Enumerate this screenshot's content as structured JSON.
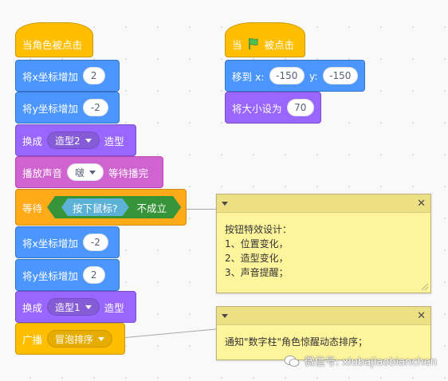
{
  "colors": {
    "events": "#ffbf00",
    "control": "#ffab19",
    "motion": "#4c97ff",
    "looks": "#9966ff",
    "sound": "#cf63cf",
    "operator": "#59c059",
    "sensing": "#5cb1d6",
    "note": "#fef49c"
  },
  "script1": {
    "hat_label": "当角色被点击",
    "change_x": {
      "label": "将x坐标增加",
      "value": "2"
    },
    "change_y": {
      "label": "将y坐标增加",
      "value": "-2"
    },
    "switch_costume": {
      "label": "换成",
      "value": "造型2",
      "suffix": "造型"
    },
    "play_sound": {
      "label": "播放声音",
      "value": "啵",
      "suffix": "等待播完"
    },
    "wait_until": {
      "label": "等待",
      "sensing": "按下鼠标?",
      "not_label": "不成立"
    },
    "change_x2": {
      "label": "将x坐标增加",
      "value": "-2"
    },
    "change_y2": {
      "label": "将y坐标增加",
      "value": "2"
    },
    "switch_costume2": {
      "label": "换成",
      "value": "造型1",
      "suffix": "造型"
    },
    "broadcast": {
      "label": "广播",
      "value": "冒泡排序"
    }
  },
  "script2": {
    "hat_prefix": "当",
    "hat_icon": "green-flag-icon",
    "hat_suffix": "被点击",
    "goto": {
      "label": "移到 x:",
      "x": "-150",
      "y_label": "y:",
      "y": "-150"
    },
    "set_size": {
      "label": "将大小设为",
      "value": "70"
    }
  },
  "note1": {
    "lines": [
      "按钮特效设计：",
      "1、位置变化，",
      "2、造型变化，",
      "3、声音提醒；"
    ]
  },
  "note2": {
    "text": "通知\"数字柱\"角色惊醒动态排序；"
  },
  "watermark": {
    "text": "微信号: xiubajiaobianchen"
  }
}
